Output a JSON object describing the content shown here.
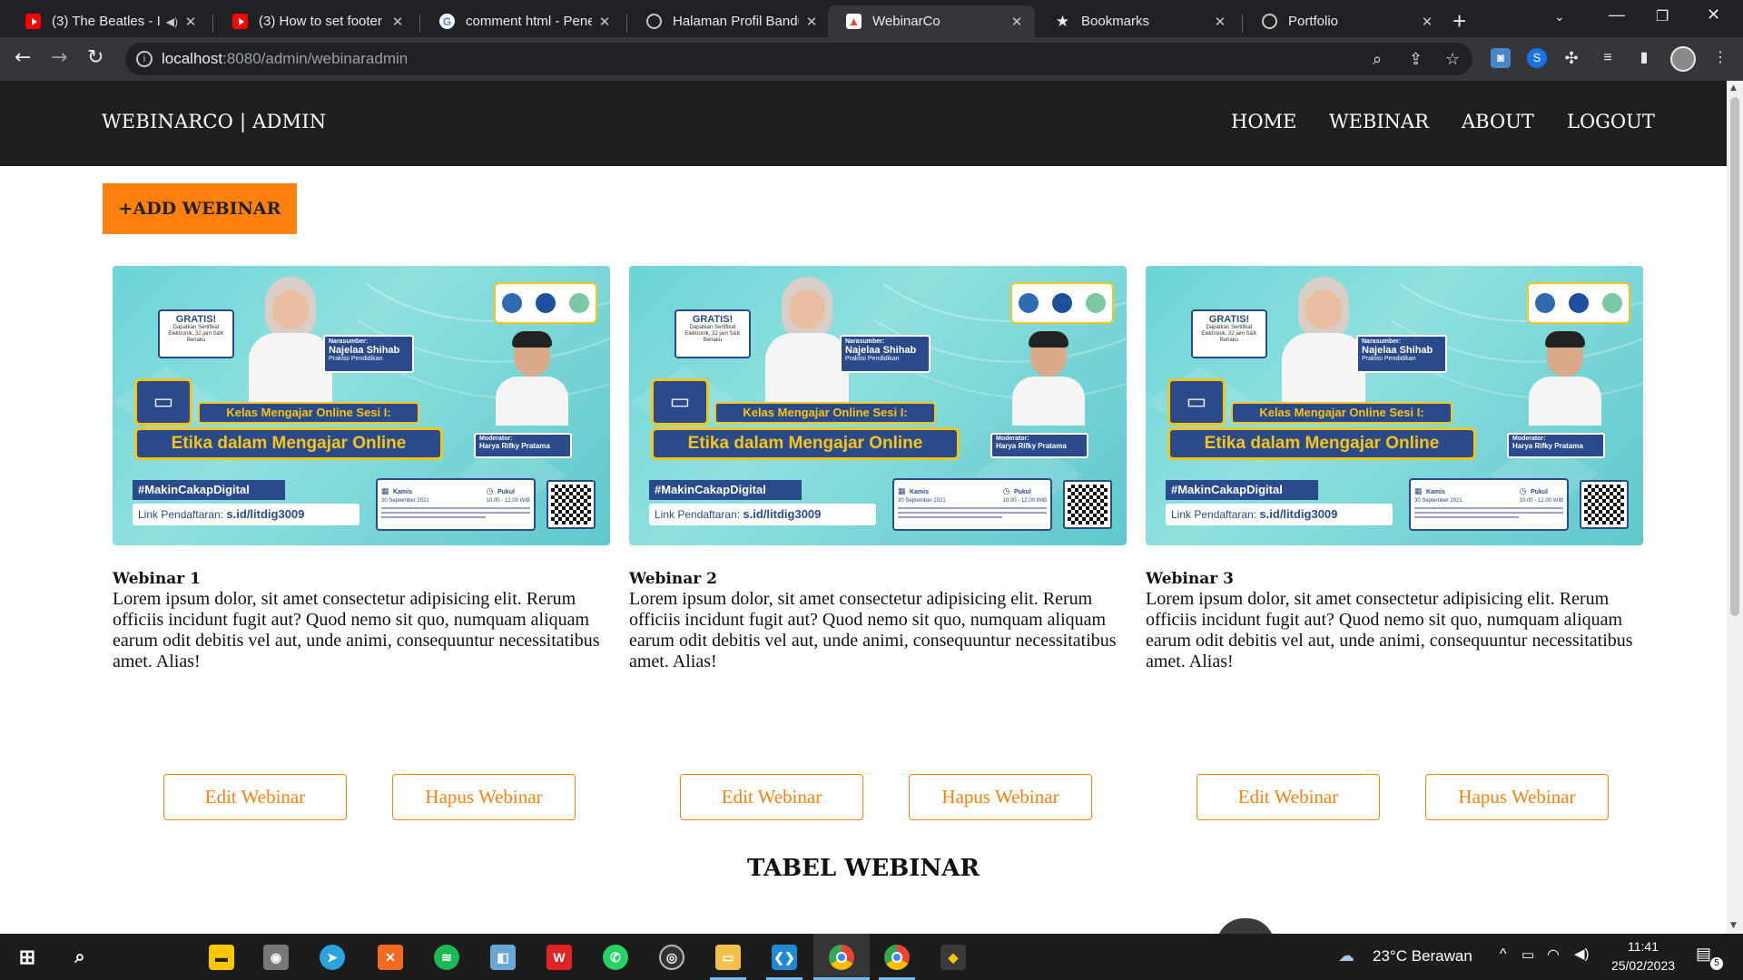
{
  "browser": {
    "tabs": [
      {
        "title": "(3) The Beatles - I",
        "favicon": "youtube-icon"
      },
      {
        "title": "(3) How to set footer",
        "favicon": "youtube-icon"
      },
      {
        "title": "comment html - Pene",
        "favicon": "google-icon"
      },
      {
        "title": "Halaman Profil Bandu",
        "favicon": "globe-icon"
      },
      {
        "title": "WebinarCo",
        "favicon": "webinarco-icon"
      },
      {
        "title": "Bookmarks",
        "favicon": "star-icon"
      },
      {
        "title": "Portfolio",
        "favicon": "globe-icon"
      }
    ],
    "url_host": "localhost",
    "url_path": ":8080/admin/webinaradmin"
  },
  "site": {
    "brand": "WEBINARCO | ADMIN",
    "menu": [
      "HOME",
      "WEBINAR",
      "ABOUT",
      "LOGOUT"
    ],
    "add_button": "+ADD WEBINAR",
    "table_heading": "TABEL WEBINAR"
  },
  "banner": {
    "gratis": "GRATIS!",
    "gratis_sub": "Dapatkan Sertifikat Elektronik, 32 jam S&K Berlaku",
    "narasumber_label": "Narasumber:",
    "narasumber_name": "Najelaa Shihab",
    "narasumber_role": "Praktisi Pendidikan",
    "title_small": "Kelas Mengajar Online Sesi I:",
    "title_big": "Etika dalam Mengajar Online",
    "moderator_label": "Moderator:",
    "moderator_name": "Harya Rifky Pratama",
    "hashtag": "#MakinCakapDigital",
    "link_label": "Link Pendaftaran:",
    "link": "s.id/litdig3009",
    "day_label": "Kamis",
    "date": "30 September 2021",
    "time_label": "Pukul",
    "time": "10.00 - 12.00 WIB"
  },
  "webinars": [
    {
      "title": "Webinar 1",
      "description": "Lorem ipsum dolor, sit amet consectetur adipisicing elit. Rerum officiis incidunt fugit aut? Quod nemo sit quo, numquam aliquam earum odit debitis vel aut, unde animi, consequuntur necessitatibus amet. Alias!",
      "edit_label": "Edit Webinar",
      "delete_label": "Hapus Webinar"
    },
    {
      "title": "Webinar 2",
      "description": "Lorem ipsum dolor, sit amet consectetur adipisicing elit. Rerum officiis incidunt fugit aut? Quod nemo sit quo, numquam aliquam earum odit debitis vel aut, unde animi, consequuntur necessitatibus amet. Alias!",
      "edit_label": "Edit Webinar",
      "delete_label": "Hapus Webinar"
    },
    {
      "title": "Webinar 3",
      "description": "Lorem ipsum dolor, sit amet consectetur adipisicing elit. Rerum officiis incidunt fugit aut? Quod nemo sit quo, numquam aliquam earum odit debitis vel aut, unde animi, consequuntur necessitatibus amet. Alias!",
      "edit_label": "Edit Webinar",
      "delete_label": "Hapus Webinar"
    }
  ],
  "taskbar": {
    "weather": "23°C  Berawan",
    "time": "11:41",
    "date": "25/02/2023",
    "notifications": "5"
  },
  "colors": {
    "accent": "#ff7f0f",
    "nav_bg": "#1f1f1f",
    "banner_teal": "#6dd4d6",
    "banner_navy": "#2b4a8b",
    "banner_yellow": "#f5c518"
  }
}
